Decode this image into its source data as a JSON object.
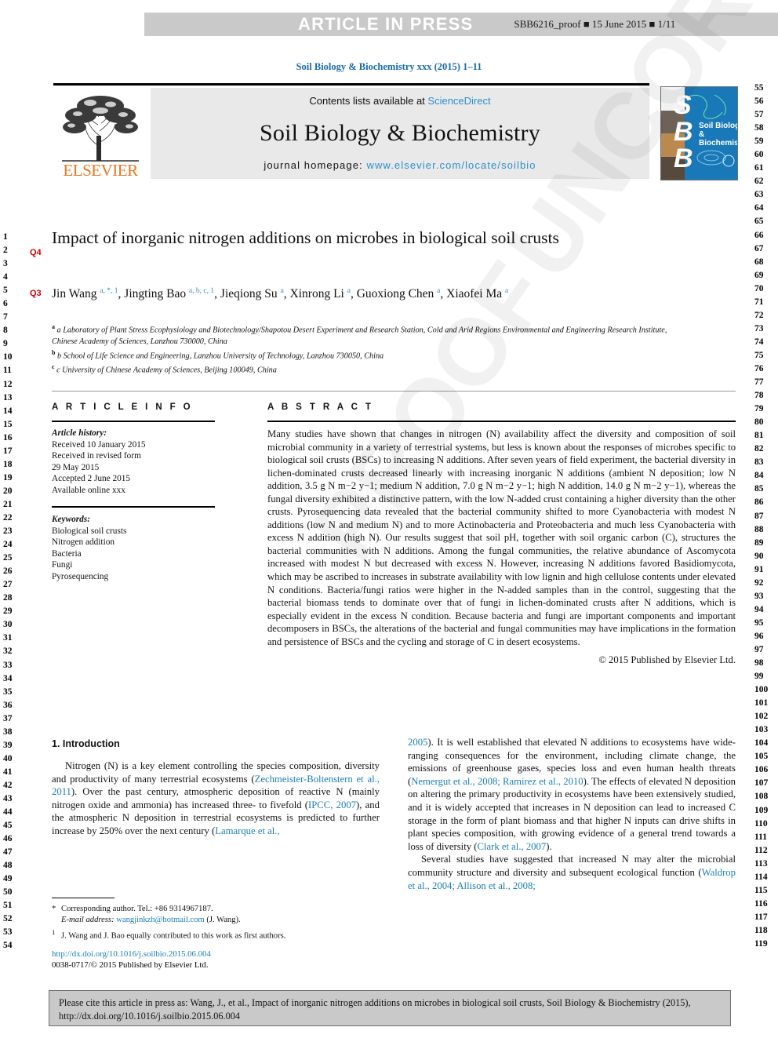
{
  "banner": {
    "title": "ARTICLE IN PRESS",
    "proof_info": "SBB6216_proof ■ 15 June 2015 ■ 1/11"
  },
  "journal_ref": "Soil Biology & Biochemistry xxx (2015) 1–11",
  "masthead": {
    "contents_prefix": "Contents lists available at ",
    "sciencedirect": "ScienceDirect",
    "journal_name": "Soil Biology & Biochemistry",
    "homepage_label": "journal homepage: ",
    "homepage_url": "www.elsevier.com/locate/soilbio",
    "publisher_logo_text": "ELSEVIER",
    "cover_letters": "S\nB\nB",
    "cover_title": "Soil Biology &\nBiochemistry"
  },
  "article": {
    "title": "Impact of inorganic nitrogen additions on microbes in biological soil crusts",
    "query_marker_title": "Q4",
    "query_marker_authors": "Q3",
    "authors_html": "Jin Wang <sup>a, *, 1</sup>, Jingting Bao <sup>a, b, c, 1</sup>, Jieqiong Su <sup>a</sup>, Xinrong Li <sup>a</sup>, Guoxiong Chen <sup>a</sup>, Xiaofei Ma <sup>a</sup>",
    "affiliations": [
      "a Laboratory of Plant Stress Ecophysiology and Biotechnology/Shapotou Desert Experiment and Research Station, Cold and Arid Regions Environmental and Engineering Research Institute, Chinese Academy of Sciences, Lanzhou 730000, China",
      "b School of Life Science and Engineering, Lanzhou University of Technology, Lanzhou 730050, China",
      "c University of Chinese Academy of Sciences, Beijing 100049, China"
    ]
  },
  "article_info": {
    "heading": "A R T I C L E   I N F O",
    "history_label": "Article history:",
    "history_lines": [
      "Received 10 January 2015",
      "Received in revised form",
      "29 May 2015",
      "Accepted 2 June 2015",
      "Available online xxx"
    ],
    "keywords_label": "Keywords:",
    "keywords": [
      "Biological soil crusts",
      "Nitrogen addition",
      "Bacteria",
      "Fungi",
      "Pyrosequencing"
    ]
  },
  "abstract": {
    "heading": "A B S T R A C T",
    "text": "Many studies have shown that changes in nitrogen (N) availability affect the diversity and composition of soil microbial community in a variety of terrestrial systems, but less is known about the responses of microbes specific to biological soil crusts (BSCs) to increasing N additions. After seven years of field experiment, the bacterial diversity in lichen-dominated crusts decreased linearly with increasing inorganic N additions (ambient N deposition; low N addition, 3.5 g N m−2 y−1; medium N addition, 7.0 g N m−2 y−1; high N addition, 14.0 g N m−2 y−1), whereas the fungal diversity exhibited a distinctive pattern, with the low N-added crust containing a higher diversity than the other crusts. Pyrosequencing data revealed that the bacterial community shifted to more Cyanobacteria with modest N additions (low N and medium N) and to more Actinobacteria and Proteobacteria and much less Cyanobacteria with excess N addition (high N). Our results suggest that soil pH, together with soil organic carbon (C), structures the bacterial communities with N additions. Among the fungal communities, the relative abundance of Ascomycota increased with modest N but decreased with excess N. However, increasing N additions favored Basidiomycota, which may be ascribed to increases in substrate availability with low lignin and high cellulose contents under elevated N conditions. Bacteria/fungi ratios were higher in the N-added samples than in the control, suggesting that the bacterial biomass tends to dominate over that of fungi in lichen-dominated crusts after N additions, which is especially evident in the excess N condition. Because bacteria and fungi are important components and important decomposers in BSCs, the alterations of the bacterial and fungal communities may have implications in the formation and persistence of BSCs and the cycling and storage of C in desert ecosystems.",
    "copyright": "© 2015 Published by Elsevier Ltd."
  },
  "introduction": {
    "heading": "1. Introduction",
    "left_paragraph": "Nitrogen (N) is a key element controlling the species composition, diversity and productivity of many terrestrial ecosystems (Zechmeister-Boltenstern et al., 2011). Over the past century, atmospheric deposition of reactive N (mainly nitrogen oxide and ammonia) has increased three- to fivefold (IPCC, 2007), and the atmospheric N deposition in terrestrial ecosystems is predicted to further increase by 250% over the next century (Lamarque et al.,",
    "right_paragraph_1": "2005). It is well established that elevated N additions to ecosystems have wide-ranging consequences for the environment, including climate change, the emissions of greenhouse gases, species loss and even human health threats (Nemergut et al., 2008; Ramirez et al., 2010). The effects of elevated N deposition on altering the primary productivity in ecosystems have been extensively studied, and it is widely accepted that increases in N deposition can lead to increased C storage in the form of plant biomass and that higher N inputs can drive shifts in plant species composition, with growing evidence of a general trend towards a loss of diversity (Clark et al., 2007).",
    "right_paragraph_2": "Several studies have suggested that increased N may alter the microbial community structure and diversity and subsequent ecological function (Waldrop et al., 2004; Allison et al., 2008;"
  },
  "footnotes": {
    "corresponding": "Corresponding author. Tel.: +86 9314967187.",
    "email_label": "E-mail address: ",
    "email": "wangjinkzh@hotmail.com",
    "email_suffix": " (J. Wang).",
    "equal_contrib": "J. Wang and J. Bao equally contributed to this work as first authors."
  },
  "doi_block": {
    "doi_url": "http://dx.doi.org/10.1016/j.soilbio.2015.06.004",
    "issn_line": "0038-0717/© 2015 Published by Elsevier Ltd."
  },
  "cite_box": {
    "text": "Please cite this article in press as: Wang, J., et al., Impact of inorganic nitrogen additions on microbes in biological soil crusts, Soil Biology & Biochemistry (2015), http://dx.doi.org/10.1016/j.soilbio.2015.06.004"
  },
  "watermark": {
    "line1": "UNCORRECTED",
    "line2": "PROOF"
  },
  "line_numbers": {
    "left_start": 1,
    "left_end": 54,
    "right_start": 55,
    "right_end": 119
  },
  "colors": {
    "link": "#1a7fb5",
    "elsevier_orange": "#E87722",
    "banner_gray": "#c9c9c9",
    "query_red": "#d00000"
  }
}
